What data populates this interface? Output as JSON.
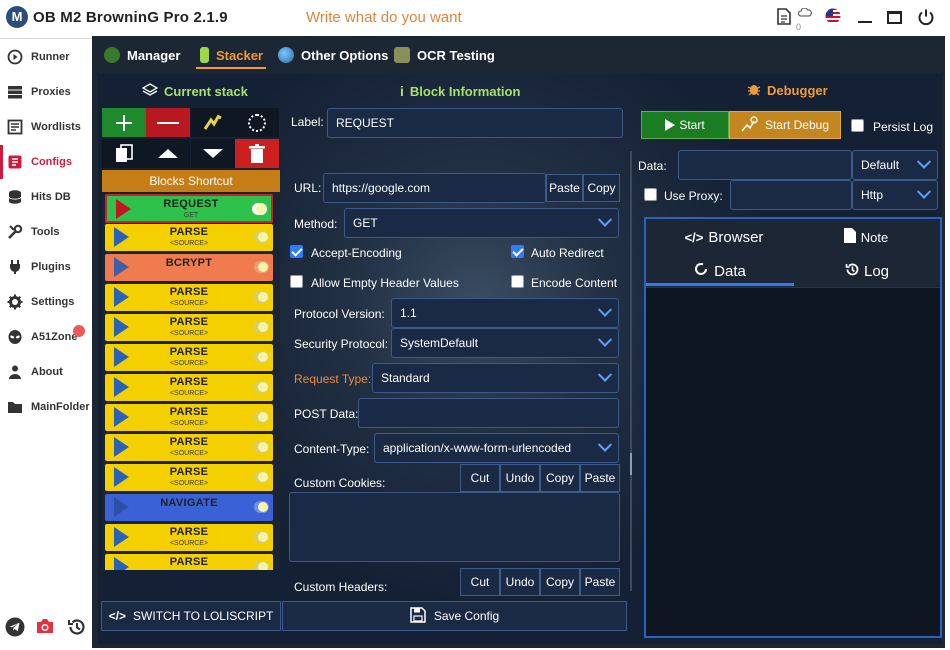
{
  "app": {
    "title": "OB M2 BrowninG Pro  2.1.9",
    "motto": "Write what do you want",
    "badge_count": "0"
  },
  "nav": {
    "items": [
      {
        "label": "Runner",
        "icon": "play-circle-icon"
      },
      {
        "label": "Proxies",
        "icon": "server-icon"
      },
      {
        "label": "Wordlists",
        "icon": "book-icon"
      },
      {
        "label": "Configs",
        "icon": "config-icon"
      },
      {
        "label": "Hits DB",
        "icon": "database-icon"
      },
      {
        "label": "Tools",
        "icon": "tools-icon"
      },
      {
        "label": "Plugins",
        "icon": "plug-icon"
      },
      {
        "label": "Settings",
        "icon": "gear-icon"
      },
      {
        "label": "A51Zone",
        "icon": "alien-icon"
      },
      {
        "label": "About",
        "icon": "person-icon"
      },
      {
        "label": "MainFolder",
        "icon": "folder-icon"
      }
    ],
    "active": "Configs"
  },
  "tabs": [
    {
      "label": "Manager",
      "icon": "manager-icon"
    },
    {
      "label": "Stacker",
      "icon": "stacker-icon"
    },
    {
      "label": "Other Options",
      "icon": "globe-icon"
    },
    {
      "label": "OCR Testing",
      "icon": "ocr-icon"
    }
  ],
  "sections": {
    "current_stack": "Current stack",
    "block_information": "Block Information",
    "debugger": "Debugger"
  },
  "stack": {
    "shortcut_label": "Blocks Shortcut",
    "blocks": [
      {
        "name": "REQUEST",
        "sub": "GET",
        "kind": "request"
      },
      {
        "name": "PARSE",
        "sub": "<SOURCE>",
        "kind": "parse"
      },
      {
        "name": "BCRYPT",
        "sub": "",
        "kind": "bcrypt"
      },
      {
        "name": "PARSE",
        "sub": "<SOURCE>",
        "kind": "parse"
      },
      {
        "name": "PARSE",
        "sub": "<SOURCE>",
        "kind": "parse"
      },
      {
        "name": "PARSE",
        "sub": "<SOURCE>",
        "kind": "parse"
      },
      {
        "name": "PARSE",
        "sub": "<SOURCE>",
        "kind": "parse"
      },
      {
        "name": "PARSE",
        "sub": "<SOURCE>",
        "kind": "parse"
      },
      {
        "name": "PARSE",
        "sub": "<SOURCE>",
        "kind": "parse"
      },
      {
        "name": "PARSE",
        "sub": "<SOURCE>",
        "kind": "parse"
      },
      {
        "name": "NAVIGATE",
        "sub": "",
        "kind": "navigate"
      },
      {
        "name": "PARSE",
        "sub": "<SOURCE>",
        "kind": "parse"
      },
      {
        "name": "PARSE",
        "sub": "<SOURCE>",
        "kind": "parse"
      },
      {
        "name": "PARSE",
        "sub": "<SOURCE>",
        "kind": "parse"
      }
    ],
    "colors": {
      "request": "#2fc24a",
      "parse": "#f5d000",
      "bcrypt": "#f07b4f",
      "navigate": "#3a62d6"
    }
  },
  "block": {
    "label_label": "Label:",
    "label_value": "REQUEST",
    "url_label": "URL:",
    "url_value": "https://google.com",
    "paste": "Paste",
    "copy": "Copy",
    "method_label": "Method:",
    "method_value": "GET",
    "accept_encoding": "Accept-Encoding",
    "auto_redirect": "Auto Redirect",
    "allow_empty": "Allow Empty Header Values",
    "encode_content": "Encode Content",
    "protocol_label": "Protocol Version:",
    "protocol_value": "1.1",
    "security_label": "Security Protocol:",
    "security_value": "SystemDefault",
    "request_type_label": "Request Type:",
    "request_type_value": "Standard",
    "post_data_label": "POST Data:",
    "content_type_label": "Content-Type:",
    "content_type_value": "application/x-www-form-urlencoded",
    "custom_cookies_label": "Custom Cookies:",
    "custom_headers_label": "Custom Headers:",
    "cut": "Cut",
    "undo": "Undo",
    "copy2": "Copy",
    "paste2": "Paste"
  },
  "debugger": {
    "start": "Start",
    "start_debug": "Start Debug",
    "persist_log": "Persist Log",
    "data_label": "Data:",
    "data_select": "Default",
    "use_proxy": "Use Proxy:",
    "proxy_type": "Http",
    "tab_browser": "Browser",
    "tab_note": "Note",
    "tab_data": "Data",
    "tab_log": "Log"
  },
  "bottom": {
    "switch": "SWITCH TO LOLISCRIPT",
    "save": "Save Config"
  }
}
